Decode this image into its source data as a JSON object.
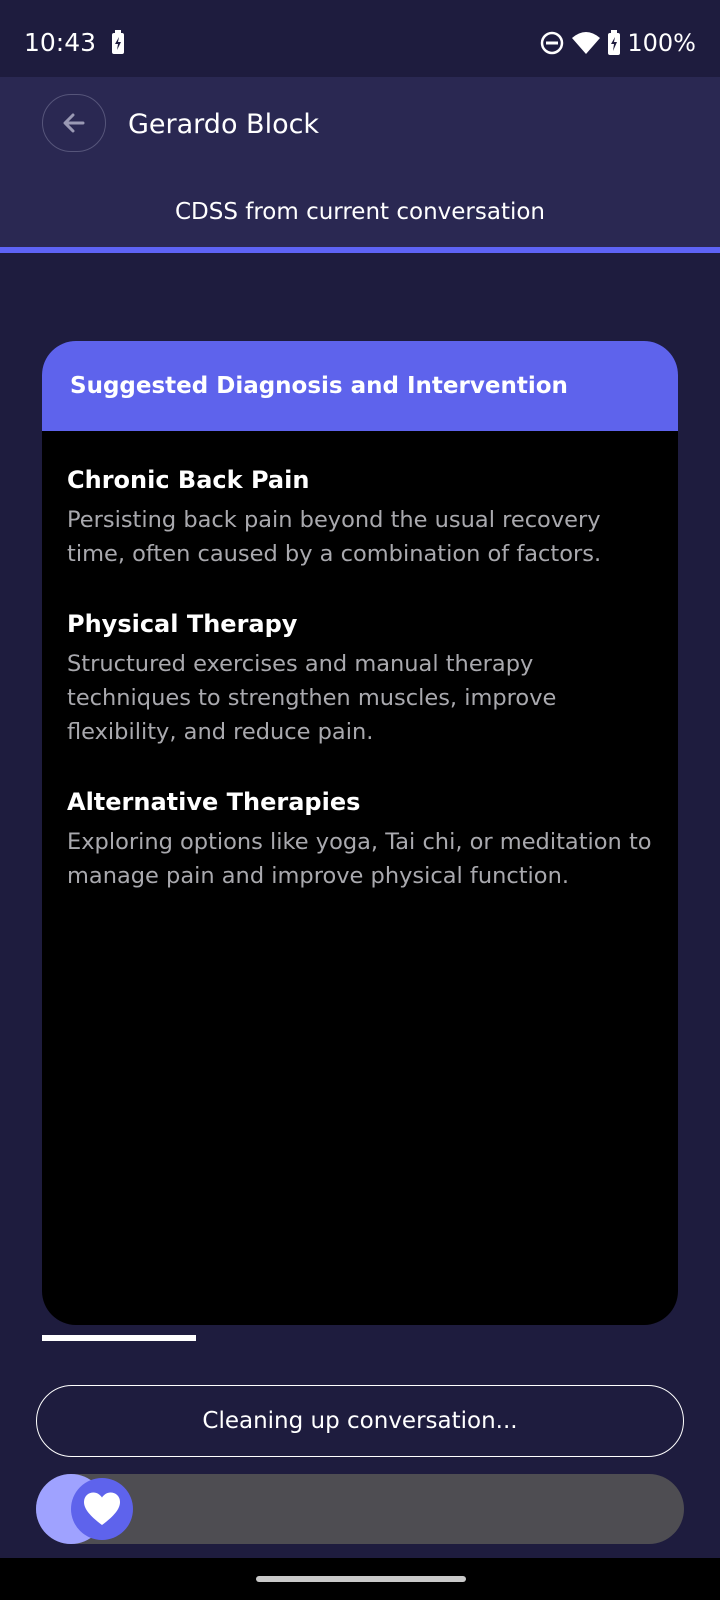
{
  "status_bar": {
    "time": "10:43",
    "battery_text": "100%",
    "icons": [
      "battery-charging-icon",
      "do-not-disturb-icon",
      "wifi-icon",
      "battery-charging-icon"
    ]
  },
  "header": {
    "title": "Gerardo Block",
    "subtitle": "CDSS from current conversation",
    "back_icon": "arrow-left-icon"
  },
  "card": {
    "title": "Suggested Diagnosis and Intervention",
    "items": [
      {
        "title": "Chronic Back Pain",
        "description": "Persisting back pain beyond the usual recovery time, often caused by a combination of factors."
      },
      {
        "title": "Physical Therapy",
        "description": "Structured exercises and manual therapy techniques to strengthen muscles, improve flexibility, and reduce pain."
      },
      {
        "title": "Alternative Therapies",
        "description": "Exploring options like yoga, Tai chi, or meditation to manage pain and improve physical function."
      }
    ]
  },
  "action": {
    "cleanup_label": "Cleaning up conversation..."
  },
  "slider": {
    "thumb_icon": "heart-icon",
    "progress_fraction": 0.1
  },
  "colors": {
    "background": "#1e1c3e",
    "header_background": "#2a2852",
    "accent": "#5e63ec",
    "slider_fill": "#9fa2ff",
    "card_background": "#000000"
  }
}
